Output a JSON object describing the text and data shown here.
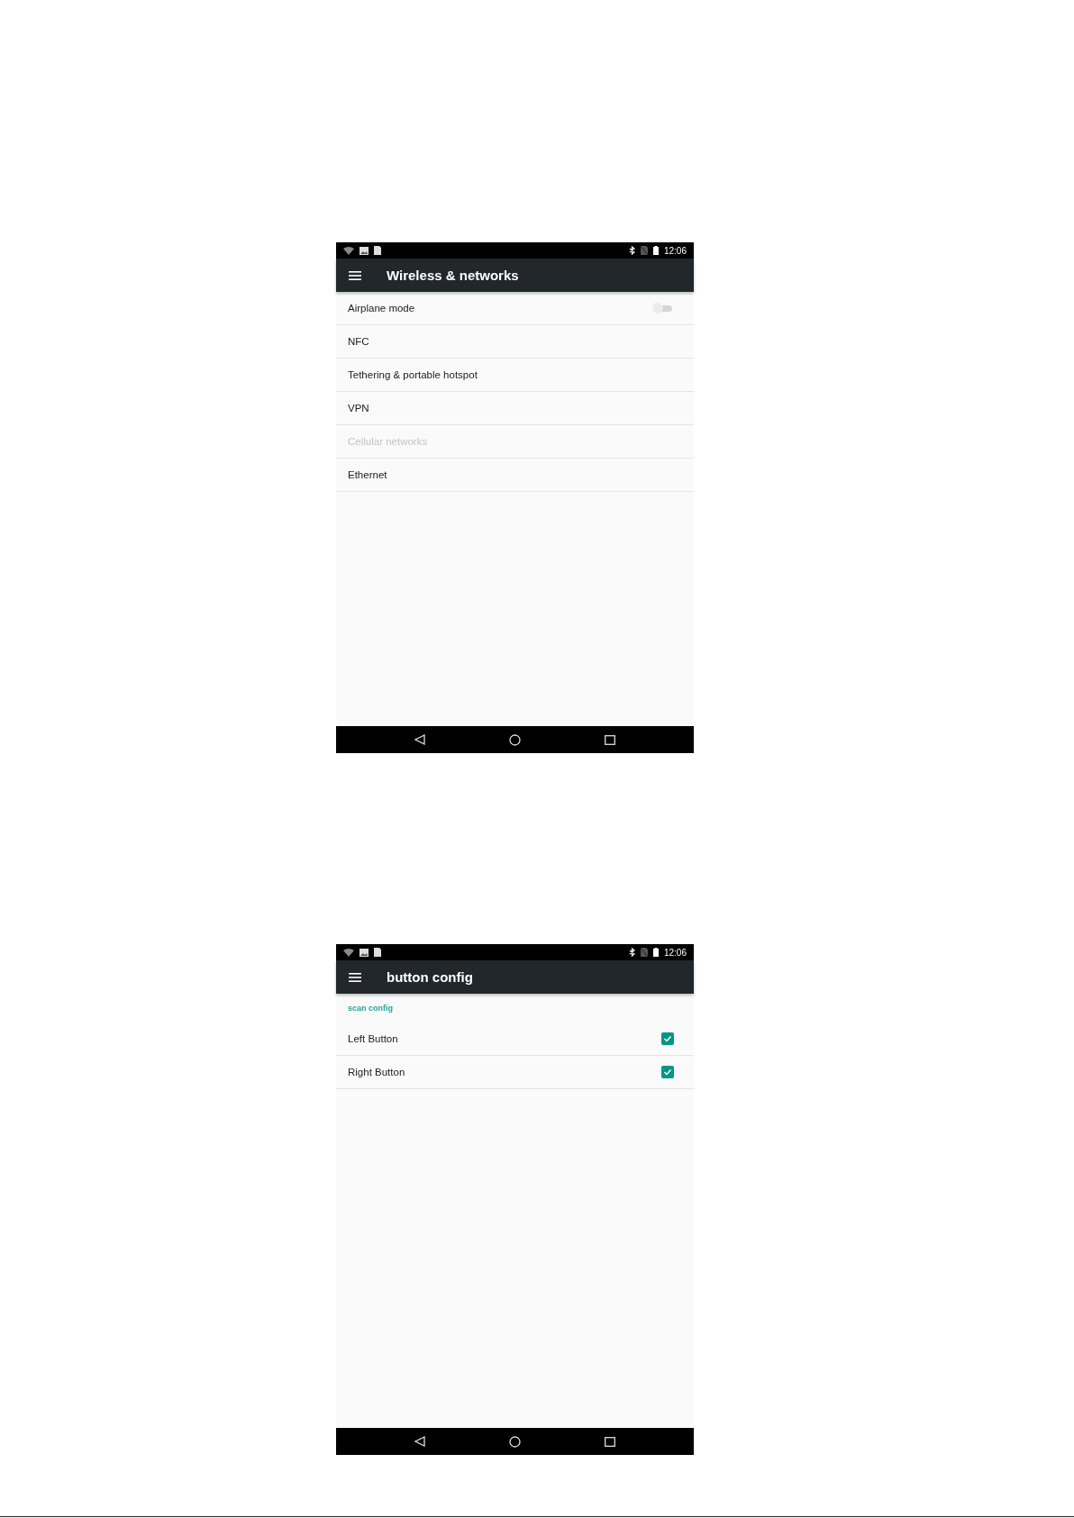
{
  "screens": [
    {
      "status_bar": {
        "time": "12:06"
      },
      "title": "Wireless & networks",
      "items": [
        {
          "kind": "switch",
          "label": "Airplane mode",
          "disabled": false,
          "on": false
        },
        {
          "kind": "plain",
          "label": "NFC",
          "disabled": false
        },
        {
          "kind": "plain",
          "label": "Tethering & portable hotspot",
          "disabled": false
        },
        {
          "kind": "plain",
          "label": "VPN",
          "disabled": false
        },
        {
          "kind": "plain",
          "label": "Cellular networks",
          "disabled": true
        },
        {
          "kind": "plain",
          "label": "Ethernet",
          "disabled": false
        }
      ]
    },
    {
      "status_bar": {
        "time": "12:06"
      },
      "title": "button config",
      "items": [
        {
          "kind": "category",
          "label": "scan config"
        },
        {
          "kind": "checkbox",
          "label": "Left Button",
          "checked": true
        },
        {
          "kind": "checkbox",
          "label": "Right Button",
          "checked": true
        }
      ]
    }
  ]
}
